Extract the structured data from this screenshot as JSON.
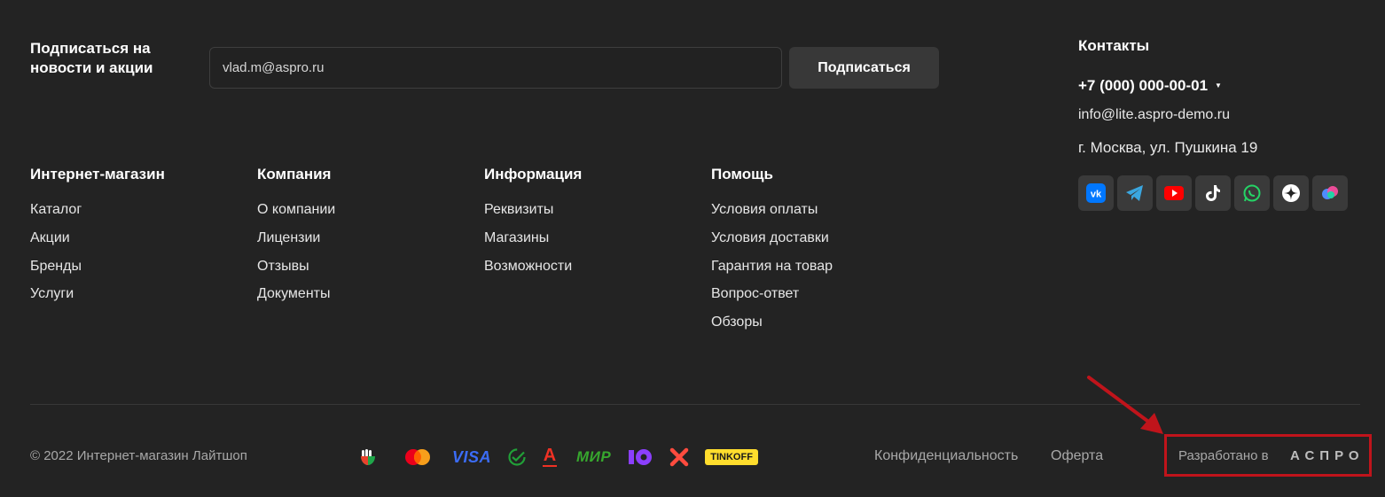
{
  "subscribe": {
    "title": "Подписаться на новости и акции",
    "email_value": "vlad.m@aspro.ru",
    "button_label": "Подписаться"
  },
  "menu": [
    {
      "title": "Интернет-магазин",
      "links": [
        "Каталог",
        "Акции",
        "Бренды",
        "Услуги"
      ]
    },
    {
      "title": "Компания",
      "links": [
        "О компании",
        "Лицензии",
        "Отзывы",
        "Документы"
      ]
    },
    {
      "title": "Информация",
      "links": [
        "Реквизиты",
        "Магазины",
        "Возможности"
      ]
    },
    {
      "title": "Помощь",
      "links": [
        "Условия оплаты",
        "Условия доставки",
        "Гарантия на товар",
        "Вопрос-ответ",
        "Обзоры"
      ]
    }
  ],
  "contacts": {
    "title": "Контакты",
    "phone": "+7 (000) 000-00-01",
    "email": "info@lite.aspro-demo.ru",
    "address": "г. Москва, ул. Пушкина 19",
    "socials": [
      "vk-icon",
      "telegram-icon",
      "youtube-icon",
      "tiktok-icon",
      "whatsapp-icon",
      "zen-icon",
      "other-social-icon"
    ]
  },
  "bottom": {
    "copyright": "© 2022 Интернет-магазин Лайтшоп",
    "payments": {
      "visa": "VISA",
      "alfa": "А",
      "mir": "МИР",
      "tinkoff": "TINKOFF"
    },
    "privacy_label": "Конфиденциальность",
    "offer_label": "Оферта",
    "developed_by": "Разработано в",
    "developer_logo": "АСПРО"
  },
  "colors": {
    "background": "#232323",
    "highlight_box": "#c0141b"
  }
}
